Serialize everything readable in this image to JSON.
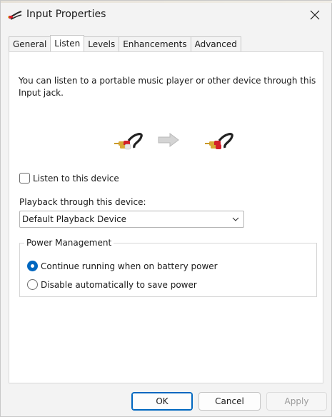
{
  "window": {
    "title": "Input Properties",
    "title_icon": "audio-cable-icon",
    "close_icon": "close-icon"
  },
  "tabs": [
    {
      "label": "General",
      "active": false
    },
    {
      "label": "Listen",
      "active": true
    },
    {
      "label": "Levels",
      "active": false
    },
    {
      "label": "Enhancements",
      "active": false
    },
    {
      "label": "Advanced",
      "active": false
    }
  ],
  "listen": {
    "description": "You can listen to a portable music player or other device through this Input jack.",
    "images": {
      "source": "rca-cable-icon",
      "arrow": "arrow-right-icon",
      "target": "rca-cable-icon"
    },
    "listen_checkbox": {
      "label": "Listen to this device",
      "checked": false
    },
    "playback_label": "Playback through this device:",
    "playback_select": {
      "value": "Default Playback Device"
    },
    "power": {
      "legend": "Power Management",
      "options": [
        {
          "label": "Continue running when on battery power",
          "selected": true
        },
        {
          "label": "Disable automatically to save power",
          "selected": false
        }
      ]
    }
  },
  "buttons": {
    "ok": "OK",
    "cancel": "Cancel",
    "apply": "Apply",
    "apply_enabled": false
  },
  "colors": {
    "accent": "#0067c0",
    "cable_red": "#d3202a",
    "cable_gold": "#d9a934"
  }
}
